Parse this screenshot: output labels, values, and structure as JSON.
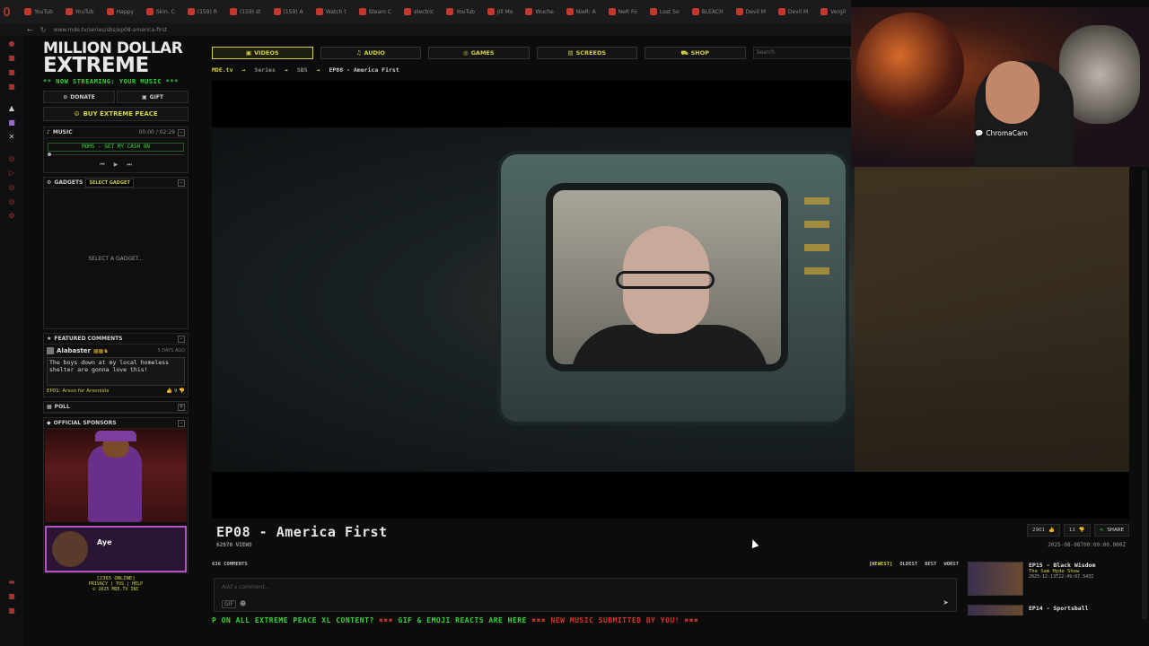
{
  "browser": {
    "tabs": [
      "YouTub",
      "YouTub",
      "Happy",
      "Skin. C",
      "(159) R",
      "(159) st",
      "(159) A",
      "Watch t",
      "Steam C",
      "electric",
      "YouTub",
      "Jill Mo",
      "Wuche",
      "NieR: A",
      "NeR Fo",
      "Lost So",
      "BLEACH",
      "Devil M",
      "Devil M",
      "Vergil"
    ],
    "url": "www.mde.tv/series/sbs/ep08-america-first"
  },
  "site": {
    "logo_line1": "MILLION DOLLAR",
    "logo_line2": "EXTREME",
    "now_streaming": "** NOW STREAMING: YOUR MUSIC ***",
    "donate": "DONATE",
    "gift": "GIFT",
    "buy_peace": "BUY EXTREME PEACE"
  },
  "music": {
    "title": "MUSIC",
    "time": "00:00 / 02:29",
    "track": "MOMS - GET MY CASH ON"
  },
  "gadgets": {
    "title": "GADGETS",
    "select": "SELECT GADGET",
    "placeholder": "SELECT A GADGET..."
  },
  "featured": {
    "title": "FEATURED COMMENTS",
    "user": "Alabaster",
    "meta": "5 DAYS AGO",
    "text": "The boys down at my local homeless shelter are gonna love this!",
    "episode": "EP01: Arson for Arsonists",
    "votes": "9"
  },
  "poll": {
    "title": "POLL"
  },
  "sponsors": {
    "title": "OFFICIAL SPONSORS",
    "second_name": "Aye"
  },
  "online": "[2365 ONLINE]",
  "footer_links": "PRIVACY | TOS | HELP",
  "copyright": "© 2025 MDE.TV INC",
  "nav": {
    "videos": "VIDEOS",
    "audio": "AUDIO",
    "games": "GAMES",
    "screeds": "SCREEDS",
    "shop": "SHOP",
    "search_placeholder": "Search"
  },
  "breadcrumb": {
    "home": "MDE.tv",
    "series": "Series",
    "show": "SBS",
    "current": "EP08 - America First"
  },
  "video": {
    "title": "EP08 - America First",
    "views": "62970 VIEWS",
    "likes": "2901",
    "dislikes": "11",
    "share": "SHARE",
    "date": "2025-08-08T00:00:00.000Z"
  },
  "comments": {
    "count": "636 COMMENTS",
    "sort": [
      "[NEWEST]",
      "OLDEST",
      "BEST",
      "WORST"
    ],
    "placeholder": "Add a comment...",
    "gif": "GIF"
  },
  "related": [
    {
      "title": "EP15 - Black Wisdom",
      "show": "The Sam Hyde Show",
      "date": "2025-12-13T22:49:07.543Z"
    },
    {
      "title": "EP14 - Sportsball",
      "show": "",
      "date": ""
    }
  ],
  "ticker": {
    "a": "P ON ALL EXTREME PEACE XL CONTENT?",
    "b": "GIF & EMOJI REACTS ARE HERE",
    "c": "NEW MUSIC SUBMITTED BY YOU!",
    "sep": "✖✖✖"
  },
  "webcam": {
    "label": "ChromaCam"
  },
  "colors": {
    "accent_yellow": "#d4d146",
    "accent_green": "#35d635",
    "alert_red": "#d23a2a",
    "sponsor_purple": "#b84fc2"
  }
}
